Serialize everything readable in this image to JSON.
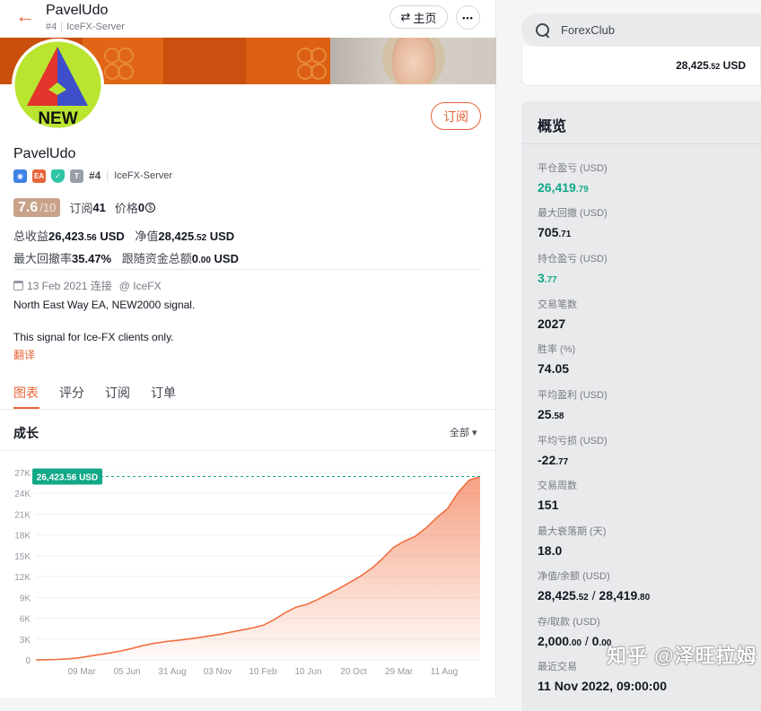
{
  "topbar": {
    "name": "PavelUdo",
    "rank": "#4",
    "server": "IceFX-Server",
    "home_label": "主页",
    "more_label": "•••"
  },
  "avatar": {
    "text": "NEW"
  },
  "subscribe_label": "订阅",
  "profile": {
    "name": "PavelUdo",
    "badges": [
      "EA",
      "T"
    ],
    "rank": "#4",
    "server": "IceFX-Server"
  },
  "stats": {
    "rating_value": "7.6",
    "rating_max": "/10",
    "subscribers_label": "订阅",
    "subscribers_value": "41",
    "price_label": "价格",
    "price_value": "0",
    "total_profit_label": "总收益",
    "total_profit_main": "26,423",
    "total_profit_dec": ".56",
    "total_profit_unit": "USD",
    "equity_label": "净值",
    "equity_main": "28,425",
    "equity_dec": ".52",
    "equity_unit": "USD",
    "max_dd_label": "最大回撤率",
    "max_dd_value": "35.47%",
    "follow_funds_label": "跟随资金总额",
    "follow_funds_main": "0",
    "follow_funds_dec": ".00",
    "follow_funds_unit": "USD"
  },
  "meta": {
    "date": "13 Feb 2021 连接",
    "broker": "@ IceFX"
  },
  "description": {
    "line1": "North East Way EA, NEW2000 signal.",
    "line2": "This signal for Ice-FX clients only.",
    "translate": "翻译"
  },
  "tabs": [
    "图表",
    "评分",
    "订阅",
    "订单"
  ],
  "growth": {
    "title": "成长",
    "filter": "全部 ▾"
  },
  "chart_data": {
    "type": "area",
    "title": "成长",
    "current_label": "26,423.56 USD",
    "current_value": 26423.56,
    "y_ticks": [
      "27K",
      "24K",
      "21K",
      "18K",
      "15K",
      "12K",
      "9K",
      "6K",
      "3K",
      "0"
    ],
    "ylim": [
      0,
      27000
    ],
    "x_ticks": [
      "09 Mar",
      "05 Jun",
      "31 Aug",
      "03 Nov",
      "10 Feb",
      "10 Jun",
      "20 Oct",
      "29 Mar",
      "11 Aug"
    ],
    "series": [
      {
        "values": [
          0,
          20,
          60,
          150,
          300,
          550,
          800,
          1050,
          1350,
          1700,
          2100,
          2400,
          2650,
          2800,
          3000,
          3200,
          3450,
          3700,
          4000,
          4300,
          4600,
          5000,
          5800,
          6800,
          7600,
          8000,
          8700,
          9500,
          10300,
          11200,
          12100,
          13200,
          14600,
          16200,
          17100,
          17800,
          19000,
          20500,
          21800,
          24200,
          25900,
          26423.56
        ]
      }
    ],
    "accent": "#f26e3f",
    "label_color": "#13a887"
  },
  "search": {
    "placeholder": "ForexClub"
  },
  "equity_card": {
    "main": "28,425",
    "dec": ".52",
    "unit": "USD"
  },
  "overview": {
    "title": "概览",
    "items": [
      {
        "label": "平仓盈亏 (USD)",
        "main": "26,419",
        "dec": ".79",
        "green": true
      },
      {
        "label": "最大回撤 (USD)",
        "main": "705",
        "dec": ".71",
        "green": false
      },
      {
        "label": "持仓盈亏 (USD)",
        "main": "3",
        "dec": ".77",
        "green": true
      },
      {
        "label": "交易笔数",
        "main": "2027",
        "dec": "",
        "green": false
      },
      {
        "label": "胜率 (%)",
        "main": "74.05",
        "dec": "",
        "green": false
      },
      {
        "label": "平均盈利 (USD)",
        "main": "25",
        "dec": ".58",
        "green": false
      },
      {
        "label": "平均亏损 (USD)",
        "main": "-22",
        "dec": ".77",
        "green": false
      },
      {
        "label": "交易周数",
        "main": "151",
        "dec": "",
        "green": false
      },
      {
        "label": "最大衰落期 (天)",
        "main": "18.0",
        "dec": "",
        "green": false
      },
      {
        "label": "净值/余额 (USD)",
        "main": "28,425",
        "dec": ".52",
        "main2": "28,419",
        "dec2": ".80",
        "green": false
      },
      {
        "label": "存/取款 (USD)",
        "main": "2,000",
        "dec": ".00",
        "main2": "0",
        "dec2": ".00",
        "green": false
      },
      {
        "label": "最近交易",
        "main": "11 Nov 2022, 09:00:00",
        "dec": "",
        "green": false
      }
    ]
  },
  "watermark": "知乎 @泽旺拉姆"
}
